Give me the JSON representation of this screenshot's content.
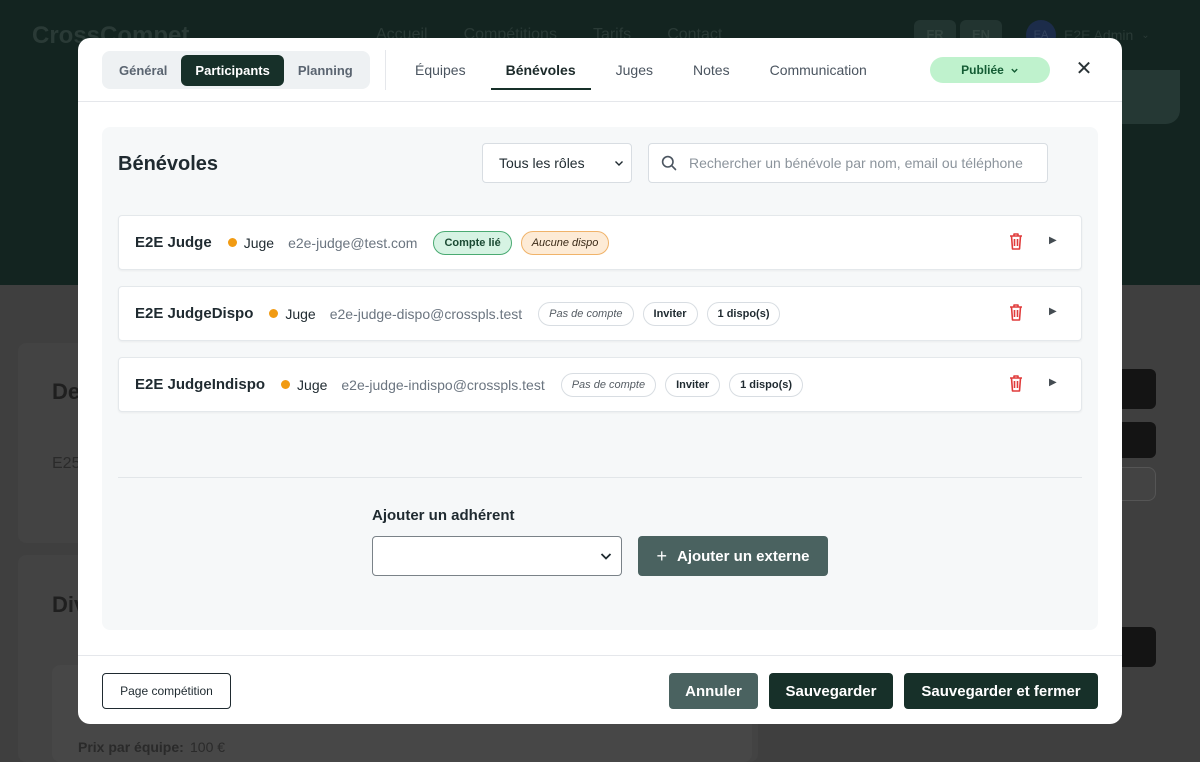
{
  "background": {
    "logo": "CrossCompet",
    "nav": [
      "Accueil",
      "Compétitions",
      "Tarifs",
      "Contact"
    ],
    "languages": [
      "FR",
      "EN"
    ],
    "user_initials": "EA",
    "user_name": "E2E Admin",
    "section_1_fragment": "De",
    "text_fragment": "E25",
    "section_2_fragment": "Div",
    "price_label": "Prix par équipe:",
    "price_value": "100 €"
  },
  "modal": {
    "segments": [
      "Général",
      "Participants",
      "Planning"
    ],
    "active_segment": "Participants",
    "tabs": [
      "Équipes",
      "Bénévoles",
      "Juges",
      "Notes",
      "Communication"
    ],
    "active_tab": "Bénévoles",
    "status": "Publiée",
    "section_title": "Bénévoles",
    "role_filter": {
      "selected": "Tous les rôles"
    },
    "search": {
      "placeholder": "Rechercher un bénévole par nom, email ou téléphone",
      "value": ""
    },
    "volunteers": [
      {
        "name": "E2E Judge",
        "role": "Juge",
        "email": "e2e-judge@test.com",
        "account": "Compte lié",
        "account_linked": true,
        "invite": null,
        "dispo": "Aucune dispo",
        "dispo_none": true
      },
      {
        "name": "E2E JudgeDispo",
        "role": "Juge",
        "email": "e2e-judge-dispo@crosspls.test",
        "account": "Pas de compte",
        "account_linked": false,
        "invite": "Inviter",
        "dispo": "1 dispo(s)",
        "dispo_none": false
      },
      {
        "name": "E2E JudgeIndispo",
        "role": "Juge",
        "email": "e2e-judge-indispo@crosspls.test",
        "account": "Pas de compte",
        "account_linked": false,
        "invite": "Inviter",
        "dispo": "1 dispo(s)",
        "dispo_none": false
      }
    ],
    "add_member_label": "Ajouter un adhérent",
    "add_member_value": "",
    "add_external_label": "Ajouter un externe",
    "footer": {
      "page_button": "Page compétition",
      "cancel": "Annuler",
      "save": "Sauvegarder",
      "save_close": "Sauvegarder et fermer"
    }
  },
  "colors": {
    "primary_dark": "#173029",
    "secondary": "#4a6260",
    "status_green_bg": "#bff2cd",
    "role_dot": "#f19b13",
    "trash_red": "#e03b3b"
  }
}
